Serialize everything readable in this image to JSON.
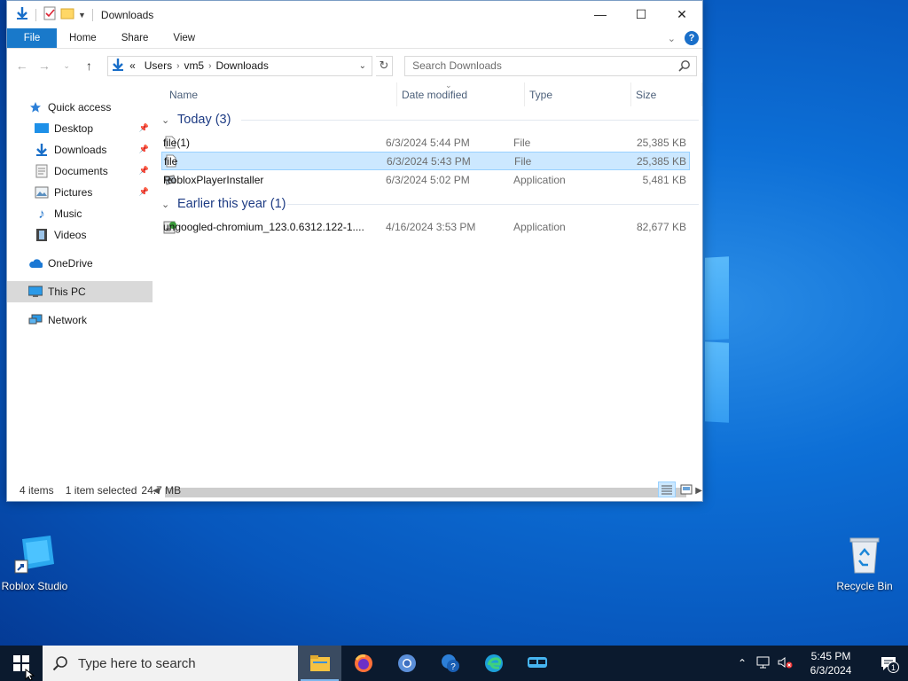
{
  "window": {
    "title": "Downloads",
    "ribbon_tabs": [
      "File",
      "Home",
      "Share",
      "View"
    ],
    "address": [
      "Users",
      "vm5",
      "Downloads"
    ],
    "address_prefix": "«",
    "search_placeholder": "Search Downloads"
  },
  "nav": {
    "quick_access": "Quick access",
    "quick_items": [
      "Desktop",
      "Downloads",
      "Documents",
      "Pictures",
      "Music",
      "Videos"
    ],
    "onedrive": "OneDrive",
    "this_pc": "This PC",
    "network": "Network"
  },
  "columns": [
    "Name",
    "Date modified",
    "Type",
    "Size"
  ],
  "groups": [
    {
      "label": "Today (3)",
      "files": [
        {
          "name": "file(1)",
          "date": "6/3/2024 5:44 PM",
          "type": "File",
          "size": "25,385 KB",
          "icon": "blank-file-icon"
        },
        {
          "name": "file",
          "date": "6/3/2024 5:43 PM",
          "type": "File",
          "size": "25,385 KB",
          "icon": "blank-file-icon",
          "selected": true
        },
        {
          "name": "RobloxPlayerInstaller",
          "date": "6/3/2024 5:02 PM",
          "type": "Application",
          "size": "5,481 KB",
          "icon": "roblox-installer-icon"
        }
      ]
    },
    {
      "label": "Earlier this year (1)",
      "files": [
        {
          "name": "ungoogled-chromium_123.0.6312.122-1....",
          "date": "4/16/2024 3:53 PM",
          "type": "Application",
          "size": "82,677 KB",
          "icon": "installer-icon"
        }
      ]
    }
  ],
  "status": {
    "count": "4 items",
    "selection": "1 item selected",
    "size": "24.7 MB"
  },
  "desktop": {
    "roblox_studio": "Roblox Studio",
    "recycle_bin": "Recycle Bin"
  },
  "taskbar": {
    "search_placeholder": "Type here to search",
    "time": "5:45 PM",
    "date": "6/3/2024",
    "notification_count": "1"
  },
  "colors": {
    "accent": "#1979ca",
    "selection": "#cce8ff",
    "taskbar": "#0b1a2e"
  }
}
